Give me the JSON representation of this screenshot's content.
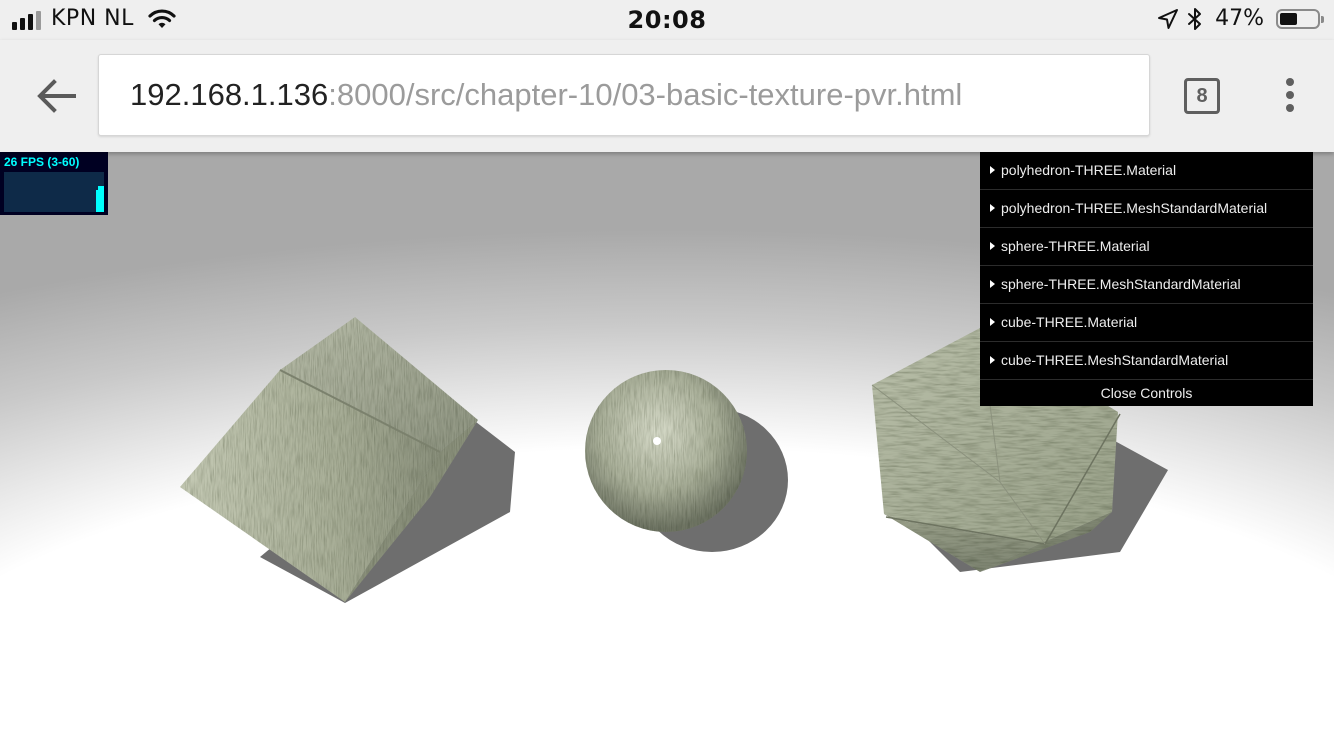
{
  "status_bar": {
    "carrier": "KPN NL",
    "time": "20:08",
    "battery_percent": "47%",
    "battery_level": 0.47,
    "signal_icon": "cellular-signal-icon",
    "wifi_icon": "wifi-icon",
    "location_icon": "location-arrow-icon",
    "bluetooth_icon": "bluetooth-icon"
  },
  "browser": {
    "url_host": "192.168.1.136",
    "url_path": ":8000/src/chapter-10/03-basic-texture-pvr.html",
    "tab_count": "8",
    "back_icon": "back-arrow-icon",
    "menu_icon": "more-vert-icon"
  },
  "stats": {
    "fps_label": "26 FPS (3-60)"
  },
  "gui": {
    "folders": [
      {
        "label": "polyhedron-THREE.Material"
      },
      {
        "label": "polyhedron-THREE.MeshStandardMaterial"
      },
      {
        "label": "sphere-THREE.Material"
      },
      {
        "label": "sphere-THREE.MeshStandardMaterial"
      },
      {
        "label": "cube-THREE.Material"
      },
      {
        "label": "cube-THREE.MeshStandardMaterial"
      }
    ],
    "close_label": "Close Controls"
  },
  "colors": {
    "stats_text": "#00ffff",
    "stats_bg": "#000022",
    "gui_bg": "#000000",
    "texture_base": "#a9b09c"
  }
}
